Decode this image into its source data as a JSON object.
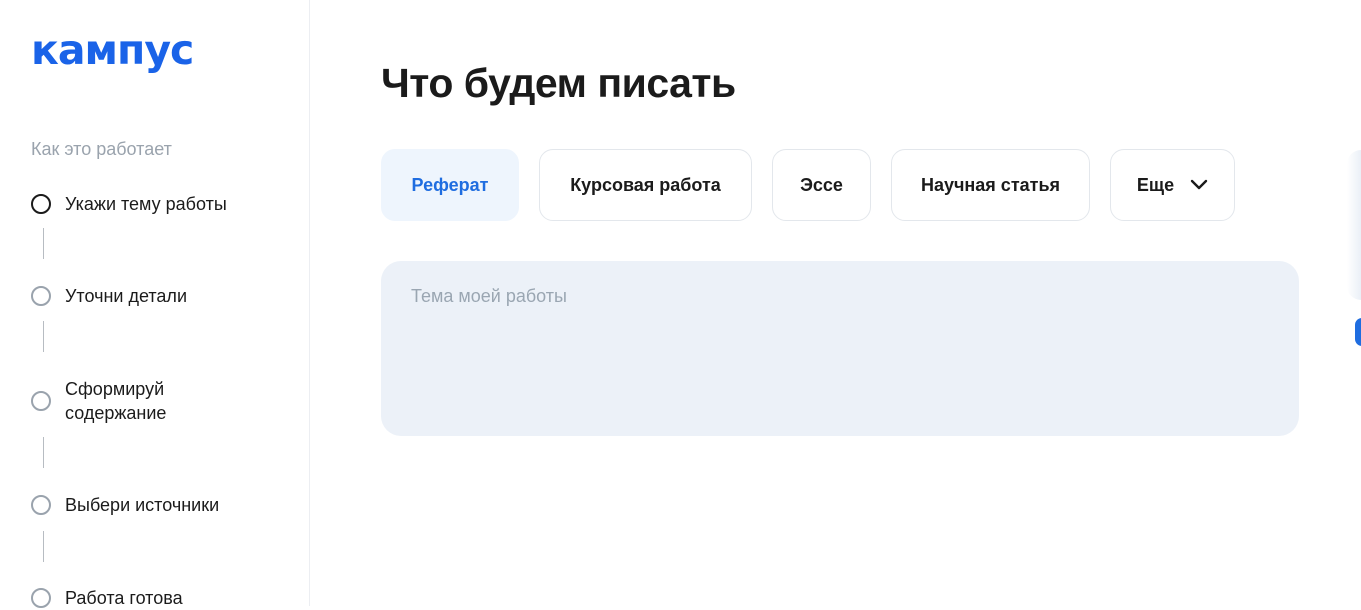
{
  "sidebar": {
    "logo": "кампус",
    "how_it_works": "Как это работает",
    "steps": [
      {
        "label": "Укажи тему работы",
        "active": true
      },
      {
        "label": "Уточни детали",
        "active": false
      },
      {
        "label": "Сформируй содержание",
        "active": false
      },
      {
        "label": "Выбери источники",
        "active": false
      },
      {
        "label": "Работа готова",
        "active": false
      }
    ]
  },
  "main": {
    "title": "Что будем писать",
    "tabs": [
      {
        "label": "Реферат",
        "selected": true
      },
      {
        "label": "Курсовая работа",
        "selected": false
      },
      {
        "label": "Эссе",
        "selected": false
      },
      {
        "label": "Научная статья",
        "selected": false
      },
      {
        "label": "Еще",
        "selected": false,
        "icon": "chevron-down-icon"
      }
    ],
    "topic_placeholder": "Тема моей работы",
    "topic_value": ""
  },
  "colors": {
    "accent": "#1f6de0",
    "logo": "#1a63e8",
    "active_tab_bg": "#eef5fd",
    "input_bg": "#ecf1f8",
    "muted_text": "#9aa3ad"
  }
}
